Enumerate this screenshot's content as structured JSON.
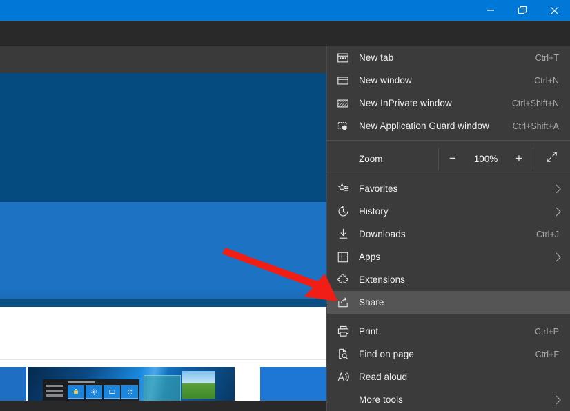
{
  "window": {
    "minimize_label": "Minimize",
    "restore_label": "Restore",
    "close_label": "Close"
  },
  "toolbar": {
    "favorites_star": "favorites-star",
    "feedback": "feedback-smiley",
    "settings_and_more": "..."
  },
  "menu": {
    "items": [
      {
        "label": "New tab",
        "accel": "Ctrl+T",
        "icon": "new-tab-icon",
        "chevron": false,
        "hovered": false
      },
      {
        "label": "New window",
        "accel": "Ctrl+N",
        "icon": "new-window-icon",
        "chevron": false,
        "hovered": false
      },
      {
        "label": "New InPrivate window",
        "accel": "Ctrl+Shift+N",
        "icon": "inprivate-icon",
        "chevron": false,
        "hovered": false
      },
      {
        "label": "New Application Guard window",
        "accel": "Ctrl+Shift+A",
        "icon": "application-guard-icon",
        "chevron": false,
        "hovered": false
      },
      {
        "label": "Favorites",
        "accel": "",
        "icon": "favorites-icon",
        "chevron": true,
        "hovered": false
      },
      {
        "label": "History",
        "accel": "",
        "icon": "history-icon",
        "chevron": true,
        "hovered": false
      },
      {
        "label": "Downloads",
        "accel": "Ctrl+J",
        "icon": "downloads-icon",
        "chevron": false,
        "hovered": false
      },
      {
        "label": "Apps",
        "accel": "",
        "icon": "apps-icon",
        "chevron": true,
        "hovered": false
      },
      {
        "label": "Extensions",
        "accel": "",
        "icon": "extensions-icon",
        "chevron": false,
        "hovered": false
      },
      {
        "label": "Share",
        "accel": "",
        "icon": "share-icon",
        "chevron": false,
        "hovered": true
      },
      {
        "label": "Print",
        "accel": "Ctrl+P",
        "icon": "print-icon",
        "chevron": false,
        "hovered": false
      },
      {
        "label": "Find on page",
        "accel": "Ctrl+F",
        "icon": "find-on-page-icon",
        "chevron": false,
        "hovered": false
      },
      {
        "label": "Read aloud",
        "accel": "",
        "icon": "read-aloud-icon",
        "chevron": false,
        "hovered": false
      },
      {
        "label": "More tools",
        "accel": "",
        "icon": "",
        "chevron": true,
        "hovered": false
      }
    ],
    "zoom": {
      "label": "Zoom",
      "value": "100%",
      "minus_label": "−",
      "plus_label": "+",
      "fullscreen_icon": "fullscreen-icon"
    }
  },
  "annotation": {
    "arrow_color": "#F01E14",
    "arrow_target": "Share"
  },
  "colors": {
    "titlebar": "#0078D7",
    "toolbar": "#3A3A3A",
    "tabstrip": "#292929",
    "menu_bg": "#3B3B3B",
    "menu_hover": "#555555",
    "hero_dark": "#064B80",
    "hero_band": "#1C73C4",
    "accent_star": "#6BB9F0"
  }
}
